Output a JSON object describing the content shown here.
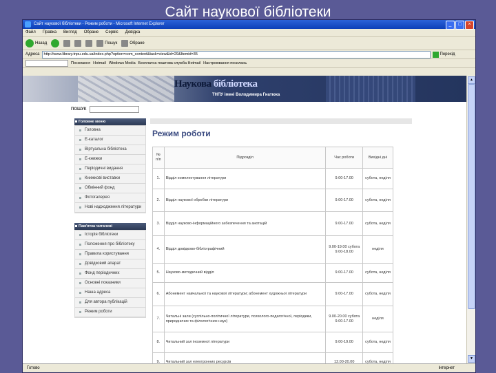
{
  "slide": {
    "title": "Сайт наукової бібліотеки"
  },
  "browser": {
    "window_title": "Сайт наукової бібліотеки - Режим роботи - Microsoft Internet Explorer",
    "menu": [
      "Файл",
      "Правка",
      "Вигляд",
      "Обране",
      "Сервіс",
      "Довідка"
    ],
    "toolbar": {
      "back": "Назад",
      "search": "Пошук",
      "favorites": "Обране"
    },
    "address_label": "Адреса",
    "address_value": "http://www.library.tnpu.edu.ua/index.php?option=com_content&task=view&id=29&Itemid=35",
    "go_label": "Перехід",
    "links_label": "Посилання",
    "links_bar": [
      "Посилання",
      "Hotmail",
      "Windows Media",
      "Безплатна поштова служба Hotmail",
      "Настроювання посилань"
    ],
    "status_left": "Готово",
    "status_right": "Інтернет"
  },
  "site": {
    "logo_part1": "Наукова",
    "logo_part2": " бібліотека",
    "subtitle": "ТНПУ імені Володимира Гнатюка",
    "search_label": "ПОШУК",
    "menu1_title": "Головне меню",
    "menu1": [
      "Головна",
      "Е-каталог",
      "Віртуальна бібліотека",
      "Е-книжки",
      "Періодичні видання",
      "Книжкові виставки",
      "Обмінний фонд",
      "Фотогалерея",
      "Нові надходження літератури"
    ],
    "menu2_title": "Пам'ятка читачеві",
    "menu2": [
      "Історія бібліотеки",
      "Положення про бібліотеку",
      "Правила користування",
      "Довідковий апарат",
      "Фонд періодичних",
      "Основні показники",
      "Наша адреса",
      "Для автора публікацій",
      "Режим роботи"
    ]
  },
  "content": {
    "page_title": "Режим роботи",
    "headers": {
      "num": "№ п/п",
      "dept": "Підрозділ",
      "time": "Час роботи",
      "off": "Вихідні дні"
    },
    "rows": [
      {
        "n": "1.",
        "dept": "Відділ комплектування літератури",
        "time": "9.00-17.00",
        "off": "субота, неділя"
      },
      {
        "n": "2.",
        "dept": "Відділ наукової обробки літератури",
        "time": "9.00-17.00",
        "off": "субота, неділя"
      },
      {
        "n": "3.",
        "dept": "Відділ науково-інформаційного забезпечення та анотацій",
        "time": "9.00-17.00",
        "off": "субота, неділя"
      },
      {
        "n": "4.",
        "dept": "Відділ довідково-бібліографічний",
        "time": "9.00-19.00 субота 9.00-18.00",
        "off": "неділя"
      },
      {
        "n": "5.",
        "dept": "Науково-методичний відділ",
        "time": "9.00-17.00",
        "off": "субота, неділя"
      },
      {
        "n": "6.",
        "dept": "Абонемент навчальної та наукової літератури; абонемент художньої літератури",
        "time": "9.00-17.00",
        "off": "субота, неділя"
      },
      {
        "n": "7.",
        "dept": "Читальні зали (суспільно-політичної літератури, психолого-педагогічної, періодики, природничих та філологічних наук)",
        "time": "9.00-20.00 субота 9.00-17.00",
        "off": "неділя"
      },
      {
        "n": "8.",
        "dept": "Читальний зал іноземної літератури",
        "time": "9.00-19.00",
        "off": "субота, неділя"
      },
      {
        "n": "9.",
        "dept": "Читальний зал електронних ресурсів",
        "time": "12.00-20.00",
        "off": "субота, неділя"
      }
    ]
  }
}
